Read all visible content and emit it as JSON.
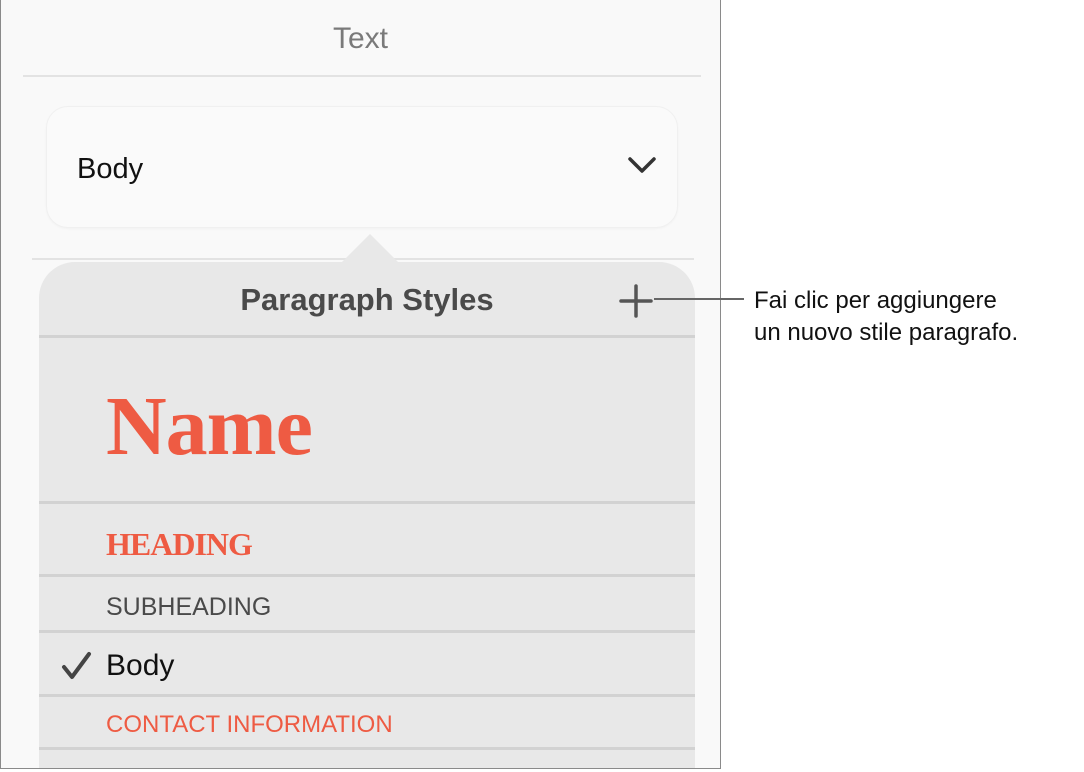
{
  "panel": {
    "title": "Text",
    "selected_style": "Body"
  },
  "popover": {
    "title": "Paragraph Styles",
    "styles": [
      {
        "label": "Name",
        "checked": false
      },
      {
        "label": "HEADING",
        "checked": false
      },
      {
        "label": "SUBHEADING",
        "checked": false
      },
      {
        "label": "Body",
        "checked": true
      },
      {
        "label": "CONTACT INFORMATION",
        "checked": false
      }
    ]
  },
  "callout": {
    "line1": "Fai clic per aggiungere",
    "line2": "un nuovo stile paragrafo."
  },
  "colors": {
    "accent": "#ee5b43",
    "popover_bg": "#e8e8e8",
    "panel_bg": "#f9f9f9"
  }
}
